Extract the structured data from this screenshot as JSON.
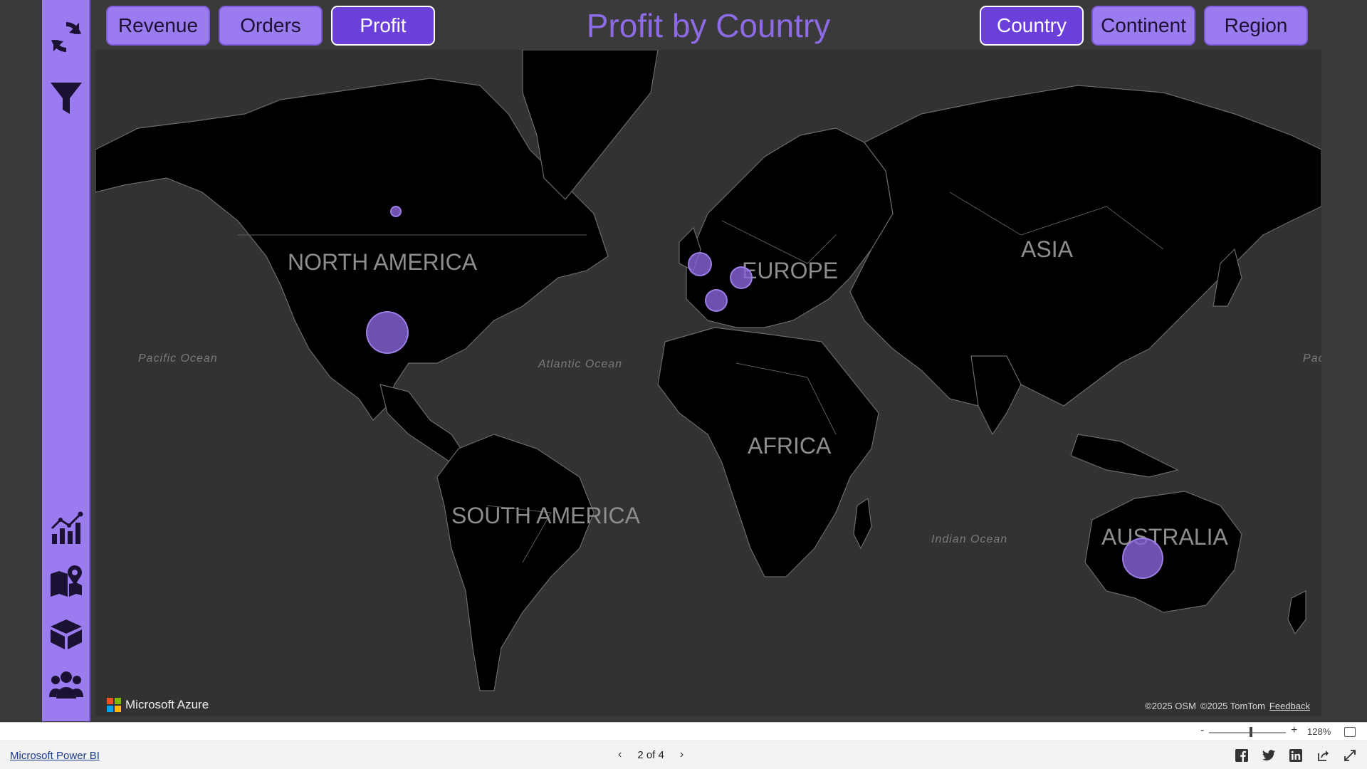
{
  "title": "Profit by Country",
  "measures": [
    "Revenue",
    "Orders",
    "Profit"
  ],
  "active_measure": "Profit",
  "granularity": [
    "Country",
    "Continent",
    "Region"
  ],
  "active_granularity": "Country",
  "map": {
    "continent_labels": [
      "NORTH AMERICA",
      "EUROPE",
      "ASIA",
      "AFRICA",
      "SOUTH AMERICA",
      "AUSTRALIA"
    ],
    "ocean_labels": [
      "Pacific Ocean",
      "Atlantic Ocean",
      "Indian Ocean",
      "Pac"
    ],
    "bubbles": [
      {
        "location": "Canada",
        "relative_size": 0.2
      },
      {
        "location": "United States",
        "relative_size": 1.0
      },
      {
        "location": "United Kingdom",
        "relative_size": 0.6
      },
      {
        "location": "Germany",
        "relative_size": 0.55
      },
      {
        "location": "France",
        "relative_size": 0.55
      },
      {
        "location": "Australia",
        "relative_size": 0.95
      }
    ],
    "provider": "Microsoft Azure",
    "attribution": [
      "©2025 OSM",
      "©2025 TomTom"
    ],
    "feedback": "Feedback"
  },
  "zoom": {
    "minus": "-",
    "plus": "+",
    "level": "128%"
  },
  "footer": {
    "brand": "Microsoft Power BI",
    "page": "2 of 4",
    "social_icons": [
      "facebook-icon",
      "twitter-icon",
      "linkedin-icon",
      "share-icon",
      "expand-icon"
    ]
  },
  "colors": {
    "accent": "#9b7cf0",
    "accent_active": "#6b3fd9",
    "title": "#8e6be6",
    "bubble": "#8662d6",
    "land": "#000000",
    "water": "#323232"
  },
  "rail_icons": [
    "refresh-icon",
    "filter-icon",
    "chart-icon",
    "map-icon",
    "box-icon",
    "users-icon"
  ]
}
